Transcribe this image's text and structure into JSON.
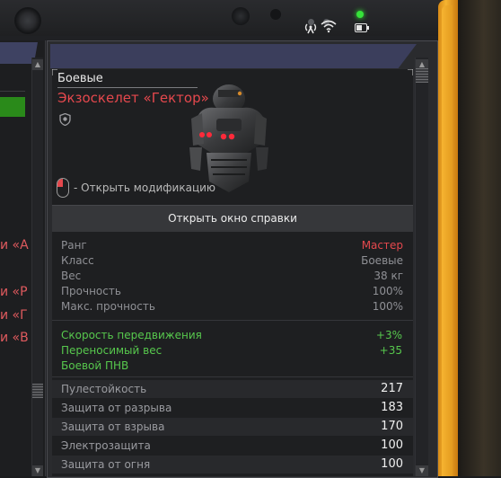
{
  "item": {
    "category": "Боевые",
    "name": "Экзоскелет «Гектор»",
    "modify_hint": "- Открыть модификацию",
    "help_button": "Открыть окно справки"
  },
  "stats": [
    {
      "label": "Ранг",
      "value": "Мастер",
      "accent": true
    },
    {
      "label": "Класс",
      "value": "Боевые",
      "accent": false
    },
    {
      "label": "Вес",
      "value": "38 кг",
      "accent": false
    },
    {
      "label": "Прочность",
      "value": "100%",
      "accent": false
    },
    {
      "label": "Макс. прочность",
      "value": "100%",
      "accent": false
    }
  ],
  "bonuses": [
    {
      "label": "Скорость передвижения",
      "value": "+3%"
    },
    {
      "label": "Переносимый вес",
      "value": "+35"
    },
    {
      "label": "Боевой ПНВ",
      "value": ""
    }
  ],
  "resistances": [
    {
      "label": "Пулестойкость",
      "value": "217"
    },
    {
      "label": "Защита от разрыва",
      "value": "183"
    },
    {
      "label": "Защита от взрыва",
      "value": "170"
    },
    {
      "label": "Электрозащита",
      "value": "100"
    },
    {
      "label": "Защита от огня",
      "value": "100"
    }
  ],
  "left_list": {
    "texts": [
      "и «А",
      "и «Р",
      "и «Г",
      "и «В"
    ]
  },
  "colors": {
    "accent_red": "#e5484d",
    "bonus_green": "#57c84d",
    "header_blue": "#3b3e5c",
    "frame_orange": "#f6b431"
  },
  "icons": {
    "wifi": "wifi-icon",
    "signal": "signal-icon",
    "battery": "battery-icon",
    "shield": "shield-icon",
    "mouse": "mouse-icon"
  }
}
